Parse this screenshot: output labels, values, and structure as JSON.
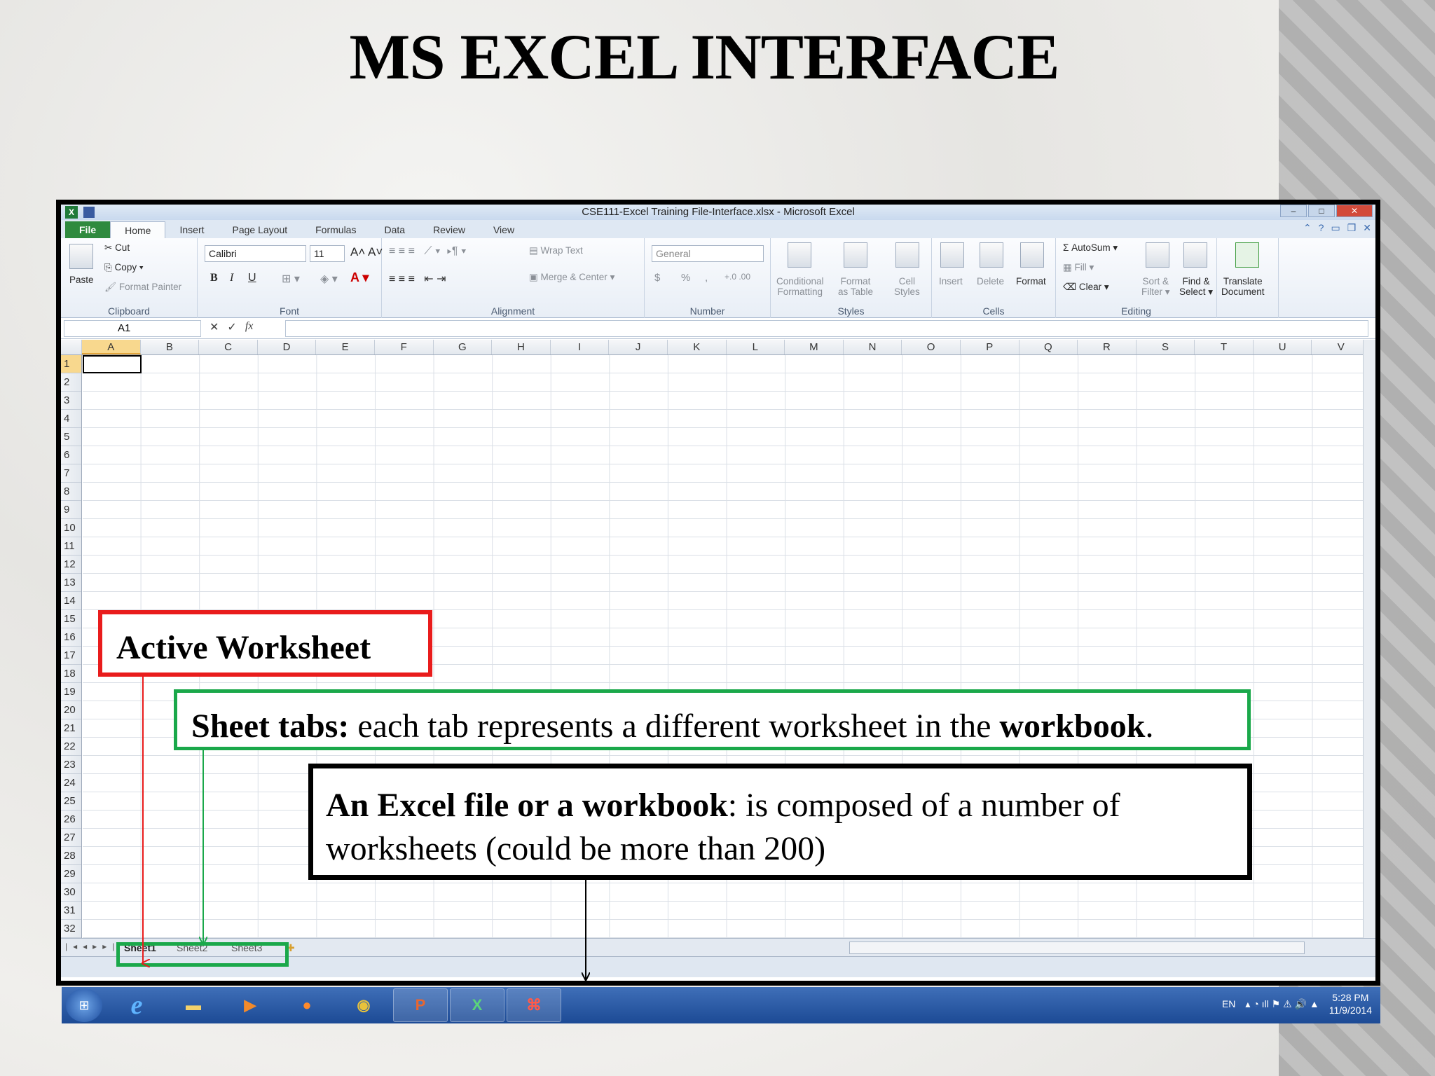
{
  "slide_title": "MS EXCEL INTERFACE",
  "window": {
    "title": "CSE111-Excel Training File-Interface.xlsx - Microsoft Excel"
  },
  "ribbon_tabs": [
    "File",
    "Home",
    "Insert",
    "Page Layout",
    "Formulas",
    "Data",
    "Review",
    "View"
  ],
  "ribbon": {
    "clipboard": {
      "paste": "Paste",
      "cut": "Cut",
      "copy": "Copy",
      "format_painter": "Format Painter",
      "label": "Clipboard"
    },
    "font": {
      "family": "Calibri",
      "size": "11",
      "bold": "B",
      "italic": "I",
      "underline": "U",
      "label": "Font"
    },
    "alignment": {
      "wrap": "Wrap Text",
      "merge": "Merge & Center",
      "label": "Alignment"
    },
    "number": {
      "format": "General",
      "currency": "$",
      "percent": "%",
      "comma": ",",
      "label": "Number"
    },
    "styles": {
      "cond": "Conditional",
      "cond2": "Formatting",
      "fmt_table": "Format",
      "fmt_table2": "as Table",
      "cell": "Cell",
      "cell2": "Styles",
      "label": "Styles"
    },
    "cells": {
      "insert": "Insert",
      "delete": "Delete",
      "format": "Format",
      "label": "Cells"
    },
    "editing": {
      "autosum": "AutoSum",
      "fill": "Fill",
      "clear": "Clear",
      "sort": "Sort &",
      "sort2": "Filter",
      "find": "Find &",
      "find2": "Select",
      "label": "Editing"
    },
    "translate": {
      "line1": "Translate",
      "line2": "Document"
    }
  },
  "formula_bar": {
    "name_box": "A1",
    "fx": "fx"
  },
  "columns": [
    "A",
    "B",
    "C",
    "D",
    "E",
    "F",
    "G",
    "H",
    "I",
    "J",
    "K",
    "L",
    "M",
    "N",
    "O",
    "P",
    "Q",
    "R",
    "S",
    "T",
    "U",
    "V"
  ],
  "rows": [
    "1",
    "2",
    "3",
    "4",
    "5",
    "6",
    "7",
    "8",
    "9",
    "10",
    "11",
    "12",
    "13",
    "14",
    "15",
    "16",
    "17",
    "18",
    "19",
    "20",
    "21",
    "22",
    "23",
    "24",
    "25",
    "26",
    "27",
    "28",
    "29",
    "30",
    "31",
    "32"
  ],
  "sheet_tabs": [
    "Sheet1",
    "Sheet2",
    "Sheet3"
  ],
  "annotations": {
    "active_worksheet": "Active Worksheet",
    "sheet_tabs_bold": "Sheet tabs:",
    "sheet_tabs_text": " each tab represents a different worksheet in the ",
    "sheet_tabs_bold2": "workbook",
    "sheet_tabs_end": ".",
    "workbook_bold": "An Excel file or a workbook",
    "workbook_text": ": is composed of a number of worksheets (could be more than 200)"
  },
  "taskbar": {
    "lang": "EN",
    "time": "5:28 PM",
    "date": "11/9/2014"
  },
  "colors": {
    "red": "#e91c1c",
    "green": "#1aa84a",
    "file_tab": "#2f8a3e",
    "taskbar": "#1c4a95"
  }
}
